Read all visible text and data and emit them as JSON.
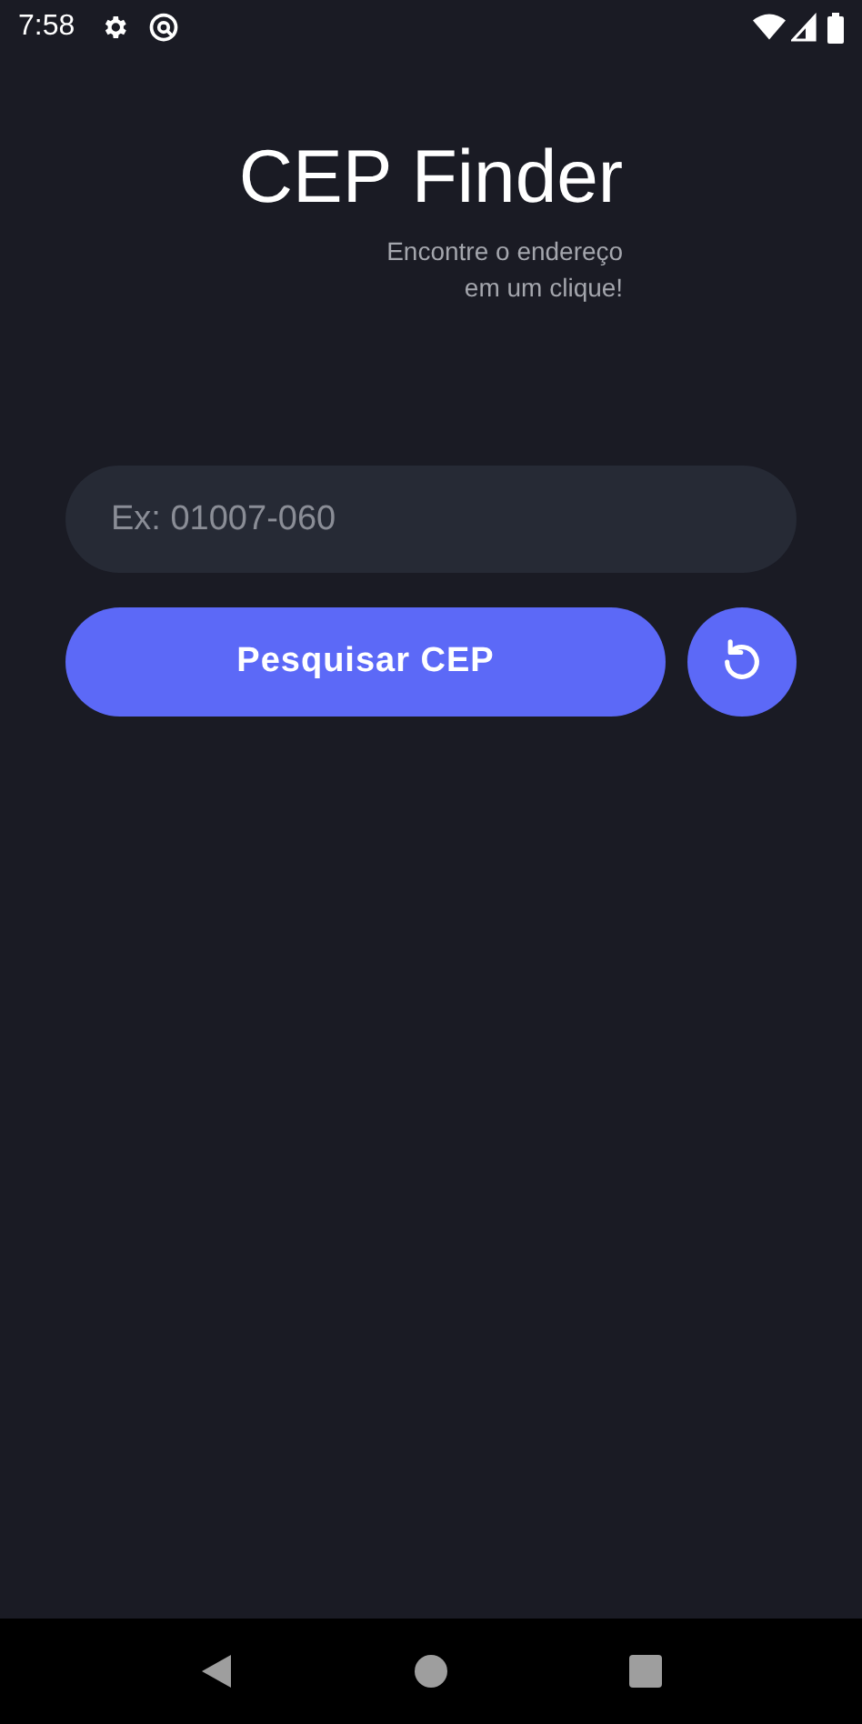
{
  "status_bar": {
    "time": "7:58"
  },
  "app": {
    "title": "CEP Finder",
    "subtitle_lines": [
      "Encontre o endereço",
      "em um clique!"
    ]
  },
  "search": {
    "placeholder": "Ex: 01007-060"
  },
  "buttons": {
    "search": "Pesquisar CEP"
  }
}
